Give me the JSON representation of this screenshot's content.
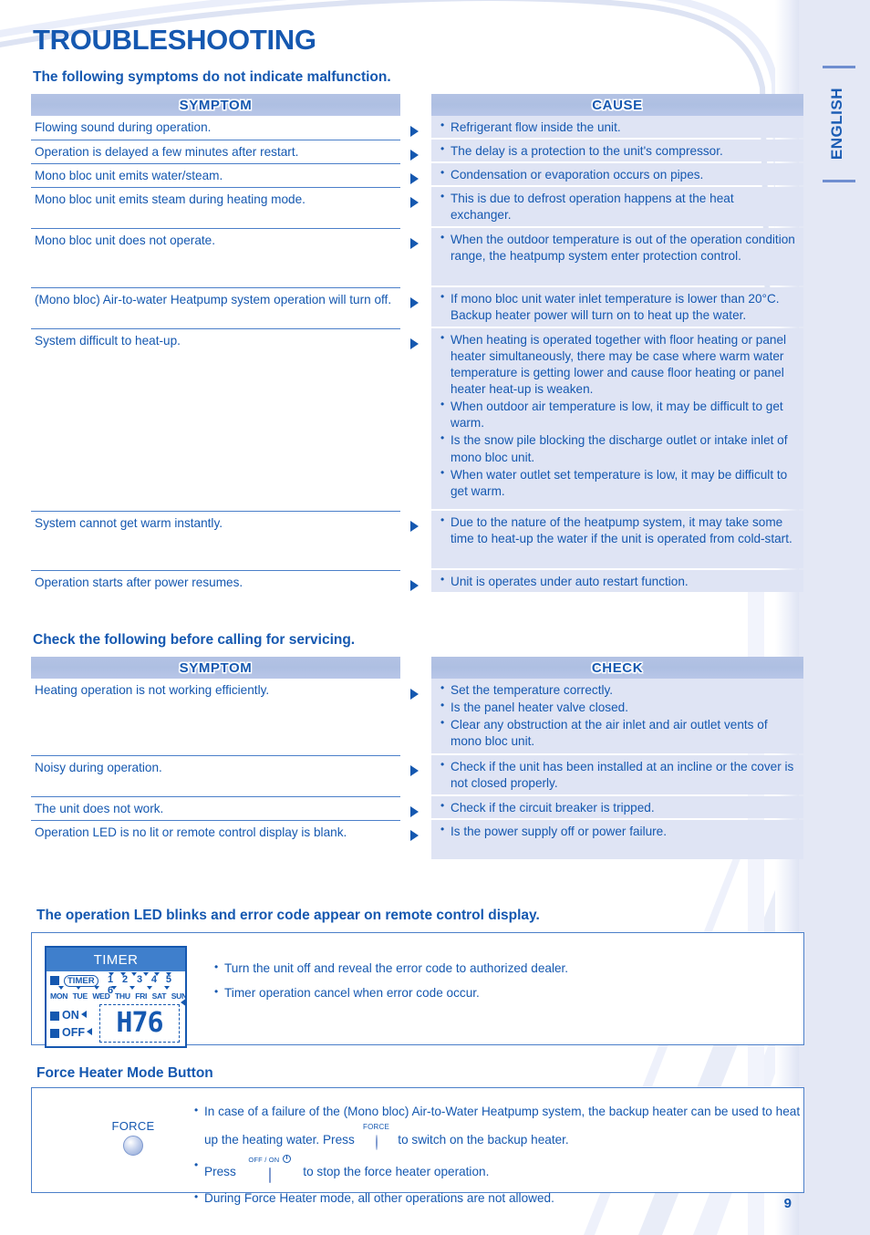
{
  "page": {
    "title": "TROUBLESHOOTING",
    "language_tab": "ENGLISH",
    "page_number": "9"
  },
  "section1": {
    "heading": "The following symptoms do not indicate malfunction.",
    "columns": {
      "symptom": "SYMPTOM",
      "cause": "CAUSE"
    },
    "rows": [
      {
        "symptom": "Flowing sound during operation.",
        "causes": [
          "Refrigerant flow inside the unit."
        ]
      },
      {
        "symptom": "Operation is delayed a few minutes after restart.",
        "causes": [
          "The delay is a protection to the unit's compressor."
        ]
      },
      {
        "symptom": "Mono bloc unit emits water/steam.",
        "causes": [
          "Condensation or evaporation occurs on pipes."
        ]
      },
      {
        "symptom": "Mono bloc unit emits steam during heating mode.",
        "causes": [
          "This is due to defrost operation happens at the heat exchanger."
        ]
      },
      {
        "symptom": "Mono bloc unit does not operate.",
        "causes": [
          "When the outdoor temperature is out of the operation condition range, the heatpump system enter protection control."
        ]
      },
      {
        "symptom": "(Mono bloc) Air-to-water Heatpump system operation will turn off.",
        "causes": [
          "If mono bloc unit water inlet temperature is lower than 20°C. Backup heater power will turn on to heat up the water."
        ]
      },
      {
        "symptom": "System difficult to heat-up.",
        "causes": [
          "When heating is operated together with floor heating or panel heater simultaneously, there may be case where warm water temperature is getting lower and cause floor heating or panel heater heat-up is weaken.",
          "When outdoor air temperature is low, it may be difficult to get warm.",
          "Is the snow pile blocking the discharge outlet or intake inlet of mono bloc unit.",
          "When water outlet set temperature is low, it may be difficult to get warm."
        ]
      },
      {
        "symptom": "System cannot get warm instantly.",
        "causes": [
          "Due to the nature of the heatpump system, it may take some time to heat-up the water if the unit is operated from cold-start."
        ]
      },
      {
        "symptom": "Operation starts after power resumes.",
        "causes": [
          "Unit is operates under auto restart function."
        ]
      }
    ]
  },
  "section2": {
    "heading": "Check the following before calling for servicing.",
    "columns": {
      "symptom": "SYMPTOM",
      "check": "CHECK"
    },
    "rows": [
      {
        "symptom": "Heating operation is not working efficiently.",
        "causes": [
          "Set the temperature correctly.",
          "Is the panel heater valve closed.",
          "Clear any obstruction at the air inlet and air outlet vents of mono bloc unit."
        ]
      },
      {
        "symptom": "Noisy during operation.",
        "causes": [
          "Check if the unit has been installed at an incline or the cover is not closed properly."
        ]
      },
      {
        "symptom": "The unit does not work.",
        "causes": [
          "Check if the circuit breaker is tripped."
        ]
      },
      {
        "symptom": "Operation LED is no lit or remote control display is blank.",
        "causes": [
          "Is the power supply off or power failure."
        ]
      }
    ]
  },
  "section3": {
    "heading": "The operation LED blinks and error code appear on remote control display.",
    "lcd": {
      "title": "TIMER",
      "timer_badge": "TIMER",
      "numbers": [
        "1",
        "2",
        "3",
        "4",
        "5",
        "6"
      ],
      "days": [
        "MON",
        "TUE",
        "WED",
        "THU",
        "FRI",
        "SAT",
        "SUN"
      ],
      "on_label": "ON",
      "off_label": "OFF",
      "error_code": "H76"
    },
    "notes": [
      "Turn the unit off and reveal the error code to authorized dealer.",
      "Timer operation cancel when error code occur."
    ]
  },
  "section4": {
    "heading": "Force Heater Mode Button",
    "button_label": "FORCE",
    "notes": [
      {
        "prefix": "In case of a failure of the (Mono bloc) Air-to-Water Heatpump system, the backup heater can be used to heat up the heating water. Press",
        "glyph": "force-button",
        "glyph_label": "FORCE",
        "suffix": "to switch on the backup heater."
      },
      {
        "prefix": "Press",
        "glyph": "off-on-button",
        "glyph_label": "OFF / ON",
        "suffix": "to stop the force heater operation."
      },
      {
        "prefix": "During Force Heater mode, all other operations are not allowed.",
        "glyph": null,
        "glyph_label": "",
        "suffix": ""
      }
    ]
  },
  "colors": {
    "brand_blue": "#1558b0",
    "header_band": "#b3c2e4",
    "cause_cell": "#dfe4f4",
    "rule": "#4b7fc9",
    "side_panel": "#e4e8f5"
  }
}
